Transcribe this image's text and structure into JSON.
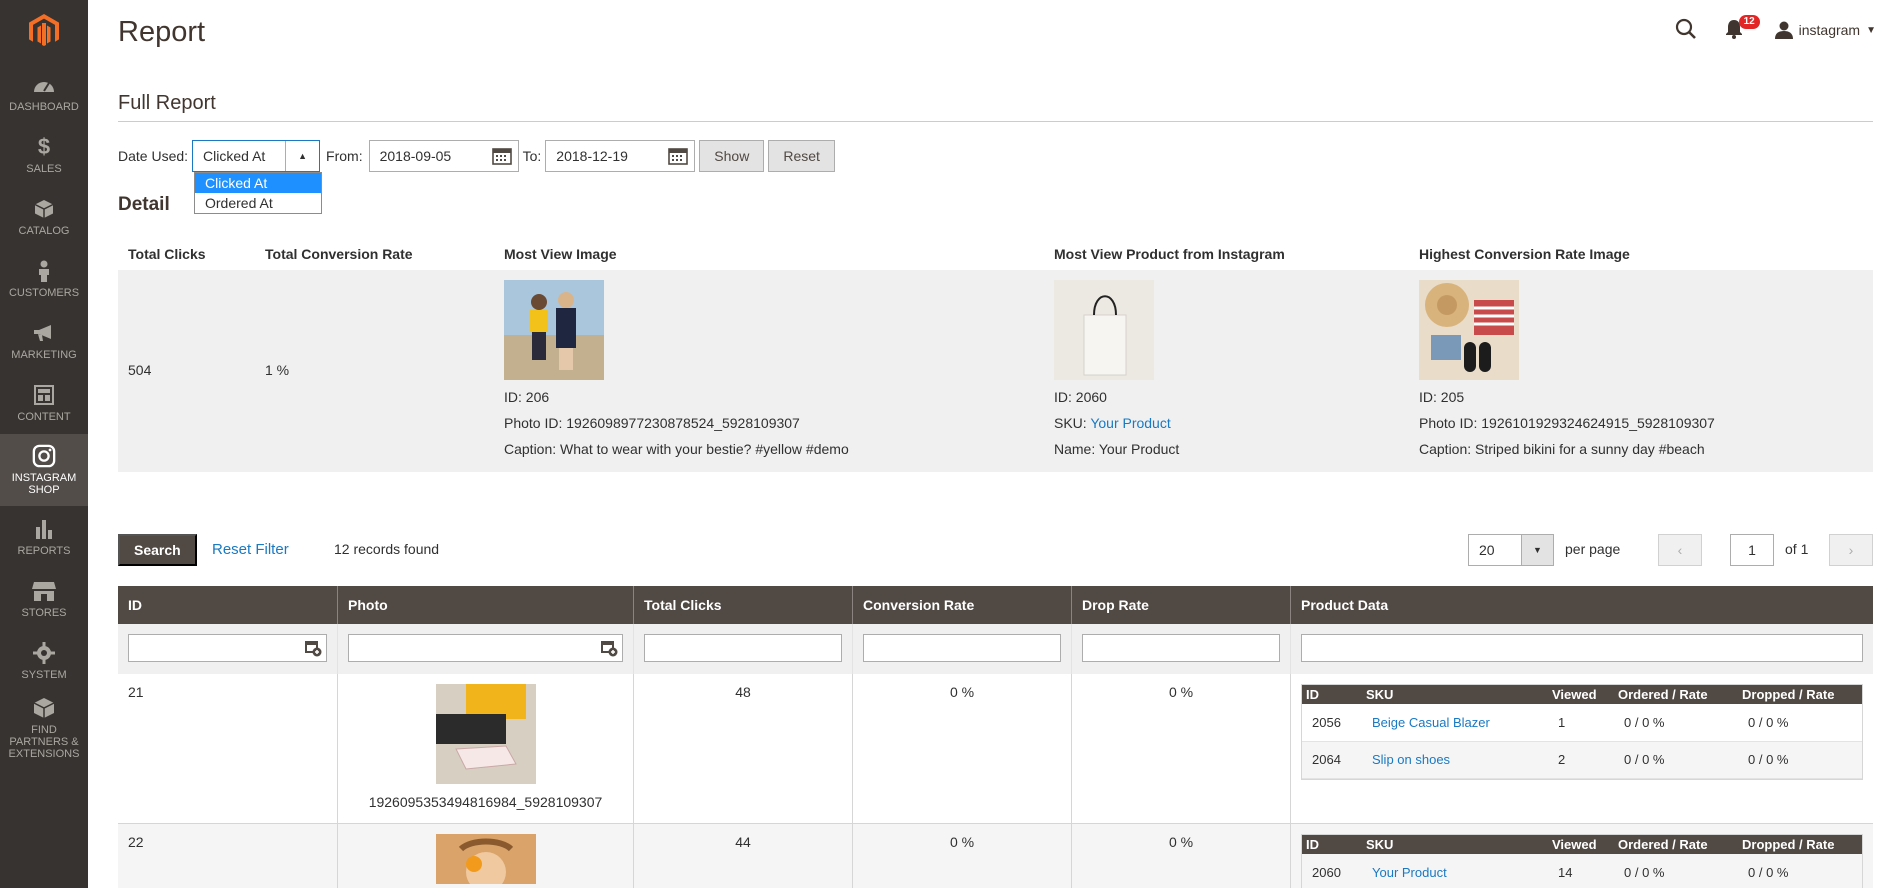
{
  "sidebar": {
    "items": [
      {
        "label": "DASHBOARD",
        "icon": "dashboard-icon"
      },
      {
        "label": "SALES",
        "icon": "dollar-icon"
      },
      {
        "label": "CATALOG",
        "icon": "cube-icon"
      },
      {
        "label": "CUSTOMERS",
        "icon": "person-icon"
      },
      {
        "label": "MARKETING",
        "icon": "megaphone-icon"
      },
      {
        "label": "CONTENT",
        "icon": "layout-icon"
      },
      {
        "label": "INSTAGRAM SHOP",
        "icon": "instagram-icon",
        "active": true
      },
      {
        "label": "REPORTS",
        "icon": "bar-chart-icon"
      },
      {
        "label": "STORES",
        "icon": "store-icon"
      },
      {
        "label": "SYSTEM",
        "icon": "gear-icon"
      },
      {
        "label": "FIND PARTNERS & EXTENSIONS",
        "icon": "box-icon"
      }
    ]
  },
  "header": {
    "title": "Report",
    "notifications": "12",
    "user": "instagram"
  },
  "report": {
    "section_title": "Full Report",
    "date_used_label": "Date Used:",
    "date_used_value": "Clicked At",
    "date_options": [
      "Clicked At",
      "Ordered At"
    ],
    "from_label": "From:",
    "from_value": "2018-09-05",
    "to_label": "To:",
    "to_value": "2018-12-19",
    "show_label": "Show",
    "reset_label": "Reset"
  },
  "detail": {
    "title": "Detail",
    "headers": [
      "Total Clicks",
      "Total Conversion Rate",
      "Most View Image",
      "Most View Product from Instagram",
      "Highest Conversion Rate Image"
    ],
    "total_clicks": "504",
    "conversion_rate": "1 %",
    "most_view_image": {
      "id": "ID: 206",
      "photo_id": "Photo ID: 1926098977230878524_5928109307",
      "caption": "Caption: What to wear with your bestie? #yellow #demo"
    },
    "most_view_product": {
      "id": "ID: 2060",
      "sku_label": "SKU: ",
      "sku": "Your Product",
      "name": "Name: Your Product"
    },
    "highest_conversion_image": {
      "id": "ID: 205",
      "photo_id": "Photo ID: 1926101929324624915_5928109307",
      "caption": "Caption: Striped bikini for a sunny day #beach"
    }
  },
  "toolbar": {
    "search_label": "Search",
    "reset_filter_label": "Reset Filter",
    "records": "12 records found",
    "per_page_value": "20",
    "per_page_label": "per page",
    "page": "1",
    "of": "of 1"
  },
  "grid": {
    "columns": [
      "ID",
      "Photo",
      "Total Clicks",
      "Conversion Rate",
      "Drop Rate",
      "Product Data"
    ],
    "sub_columns": [
      "ID",
      "SKU",
      "Viewed",
      "Ordered / Rate",
      "Dropped / Rate"
    ],
    "rows": [
      {
        "id": "21",
        "photo_id": "1926095353494816984_5928109307",
        "clicks": "48",
        "conversion": "0 %",
        "drop": "0 %",
        "products": [
          {
            "id": "2056",
            "sku": "Beige Casual Blazer",
            "viewed": "1",
            "ordered": "0 / 0 %",
            "dropped": "0 / 0 %"
          },
          {
            "id": "2064",
            "sku": "Slip on shoes",
            "viewed": "2",
            "ordered": "0 / 0 %",
            "dropped": "0 / 0 %"
          }
        ]
      },
      {
        "id": "22",
        "clicks": "44",
        "conversion": "0 %",
        "drop": "0 %",
        "products": [
          {
            "id": "2060",
            "sku": "Your Product",
            "viewed": "14",
            "ordered": "0 / 0 %",
            "dropped": "0 / 0 %"
          }
        ]
      }
    ]
  }
}
